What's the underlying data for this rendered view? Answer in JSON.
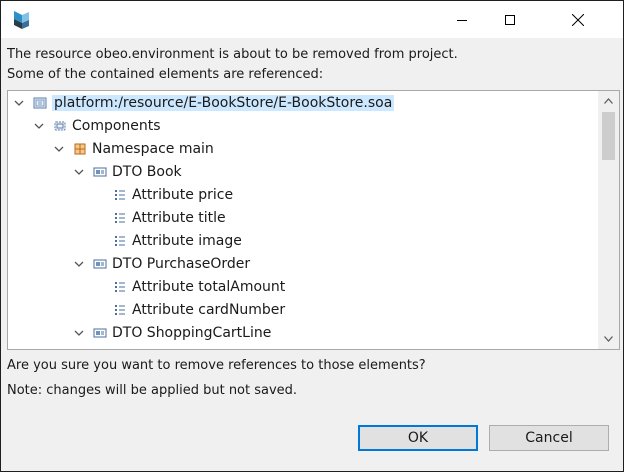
{
  "dialog": {
    "message_line1": "The resource obeo.environment is about to be removed from project.",
    "message_line2": "Some of the contained elements are referenced:",
    "question": "Are you sure you want to remove references to those elements?",
    "note": "Note: changes will be applied but not saved."
  },
  "tree": {
    "items": [
      {
        "label": "platform:/resource/E-BookStore/E-BookStore.soa",
        "icon": "resource-file-icon",
        "expanded": true,
        "selected": true
      },
      {
        "label": "Components",
        "icon": "components-icon",
        "expanded": true
      },
      {
        "label": "Namespace main",
        "icon": "namespace-icon",
        "expanded": true
      },
      {
        "label": "DTO Book",
        "icon": "dto-icon",
        "expanded": true
      },
      {
        "label": "Attribute price",
        "icon": "attribute-icon"
      },
      {
        "label": "Attribute title",
        "icon": "attribute-icon"
      },
      {
        "label": "Attribute image",
        "icon": "attribute-icon"
      },
      {
        "label": "DTO PurchaseOrder",
        "icon": "dto-icon",
        "expanded": true
      },
      {
        "label": "Attribute totalAmount",
        "icon": "attribute-icon"
      },
      {
        "label": "Attribute cardNumber",
        "icon": "attribute-icon"
      },
      {
        "label": "DTO ShoppingCartLine",
        "icon": "dto-icon",
        "expanded": true
      }
    ]
  },
  "buttons": {
    "ok_label": "OK",
    "cancel_label": "Cancel"
  },
  "colors": {
    "selection": "#cce8ff",
    "primary_border": "#0078d7"
  }
}
